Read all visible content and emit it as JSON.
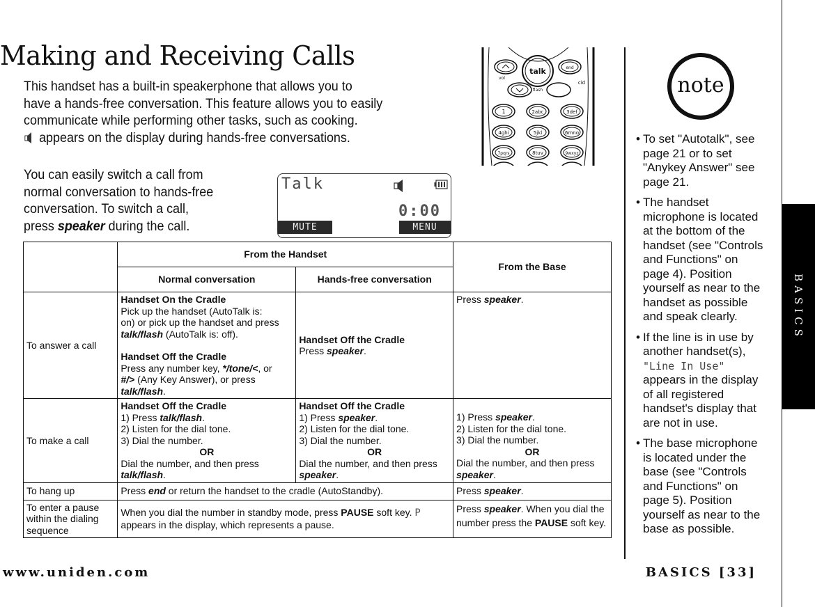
{
  "page": {
    "title": "Making and Receiving Calls",
    "intro": {
      "line1": "This handset has a built-in speakerphone that allows you to",
      "line2": "have a hands-free conversation. This feature allows you to easily",
      "line3": "communicate while performing other tasks, such as cooking.",
      "line4": "appears on the display during hands-free conversations."
    },
    "switch_text": {
      "line1": "You can easily switch a call from",
      "line2": "normal conversation to hands-free",
      "line3": "conversation. To switch a call,",
      "line4_prefix": "press ",
      "line4_key": "speaker",
      "line4_suffix": " during the call."
    }
  },
  "handset_illustration": {
    "keys": {
      "talk": "talk",
      "end": "end",
      "flash": "flash",
      "cid": "cid",
      "vol": "vol",
      "k1": "1",
      "k2": "2abc",
      "k3": "3def",
      "k4": "4ghi",
      "k5": "5jkl",
      "k6": "6mno",
      "k7": "7pqrs",
      "k8": "8tuv",
      "k9": "9wxyz"
    }
  },
  "lcd": {
    "status": "Talk",
    "timer": "0:00",
    "softkey_left": "MUTE",
    "softkey_right": "MENU"
  },
  "table": {
    "headers": {
      "from_handset": "From the Handset",
      "from_base": "From the Base",
      "normal": "Normal conversation",
      "handsfree": "Hands-free conversation"
    },
    "rows": [
      {
        "action": "To answer a call",
        "normal": {
          "h1": "Handset On the Cradle",
          "l1": "Pick up the handset (AutoTalk is:",
          "l2": "on) or pick up the handset and press",
          "l3_key": "talk/flash",
          "l3_rest": " (AutoTalk is: off).",
          "h2": "Handset Off the Cradle",
          "l4_pre": "Press any number key, ",
          "l4_key": "*/tone/<",
          "l4_post": ", or",
          "l5_key": "#/>",
          "l5_rest": " (Any Key Answer), or press",
          "l6_key": "talk/flash",
          "l6_rest": "."
        },
        "handsfree": {
          "h1": "Handset Off the Cradle",
          "pre": "Press ",
          "key": "speaker",
          "post": "."
        },
        "base": {
          "pre": "Press ",
          "key": "speaker",
          "post": "."
        }
      },
      {
        "action": "To make a call",
        "normal": {
          "h1": "Handset Off the Cradle",
          "s1_pre": "1) Press ",
          "s1_key": "talk/flash",
          "s1_post": ".",
          "s2": "2) Listen for the dial tone.",
          "s3": "3) Dial the number.",
          "or": "OR",
          "alt": "Dial the number, and then press",
          "alt_key": "talk/flash",
          "alt_post": "."
        },
        "handsfree": {
          "h1": "Handset Off the Cradle",
          "s1_pre": "1) Press ",
          "s1_key": "speaker",
          "s1_post": ".",
          "s2": "2) Listen for the dial tone.",
          "s3": "3) Dial the number.",
          "or": "OR",
          "alt": "Dial the number, and then press",
          "alt_key": "speaker",
          "alt_post": "."
        },
        "base": {
          "s1_pre": "1) Press ",
          "s1_key": "speaker",
          "s1_post": ".",
          "s2": "2) Listen for the dial tone.",
          "s3": "3) Dial the number.",
          "or": "OR",
          "alt": "Dial the number, and then press",
          "alt_key": "speaker",
          "alt_post": "."
        }
      },
      {
        "action": "To hang up",
        "handset": {
          "pre": "Press ",
          "key": "end",
          "post": " or return the handset to the cradle (AutoStandby)."
        },
        "base": {
          "pre": "Press ",
          "key": "speaker",
          "post": "."
        }
      },
      {
        "action": "To enter a pause within the dialing sequence",
        "handset": {
          "pre": "When you dial the number in standby mode, press ",
          "key": "PAUSE",
          "mid": " soft key. ",
          "glyph": "P",
          "post": "appears in the display, which represents a pause."
        },
        "base": {
          "pre": "Press ",
          "key": "speaker",
          "mid": ". When you dial the number press the ",
          "key2": "PAUSE",
          "post": " soft key."
        }
      }
    ]
  },
  "note": {
    "label": "note",
    "bullet": "•",
    "items": [
      {
        "text": "To set \"Autotalk\", see page 21 or to set \"Anykey Answer\" see page 21."
      },
      {
        "text": "The handset microphone is located at the bottom of the handset (see \"Controls and Functions\" on page 4). Position yourself as near to the handset as possible and speak clearly."
      },
      {
        "pre": "If the line is in use by another handset(s), ",
        "mono": "\"Line In Use\"",
        "post": " appears in the display of all registered handset's display that are not in use."
      },
      {
        "text": "The base microphone is located under the base (see \"Controls and Functions\" on page 5). Position yourself as near to the base as possible."
      }
    ]
  },
  "side_tab": {
    "label": "BASICS"
  },
  "footer": {
    "website": "www.uniden.com",
    "page_label": "BASICS [33]"
  }
}
